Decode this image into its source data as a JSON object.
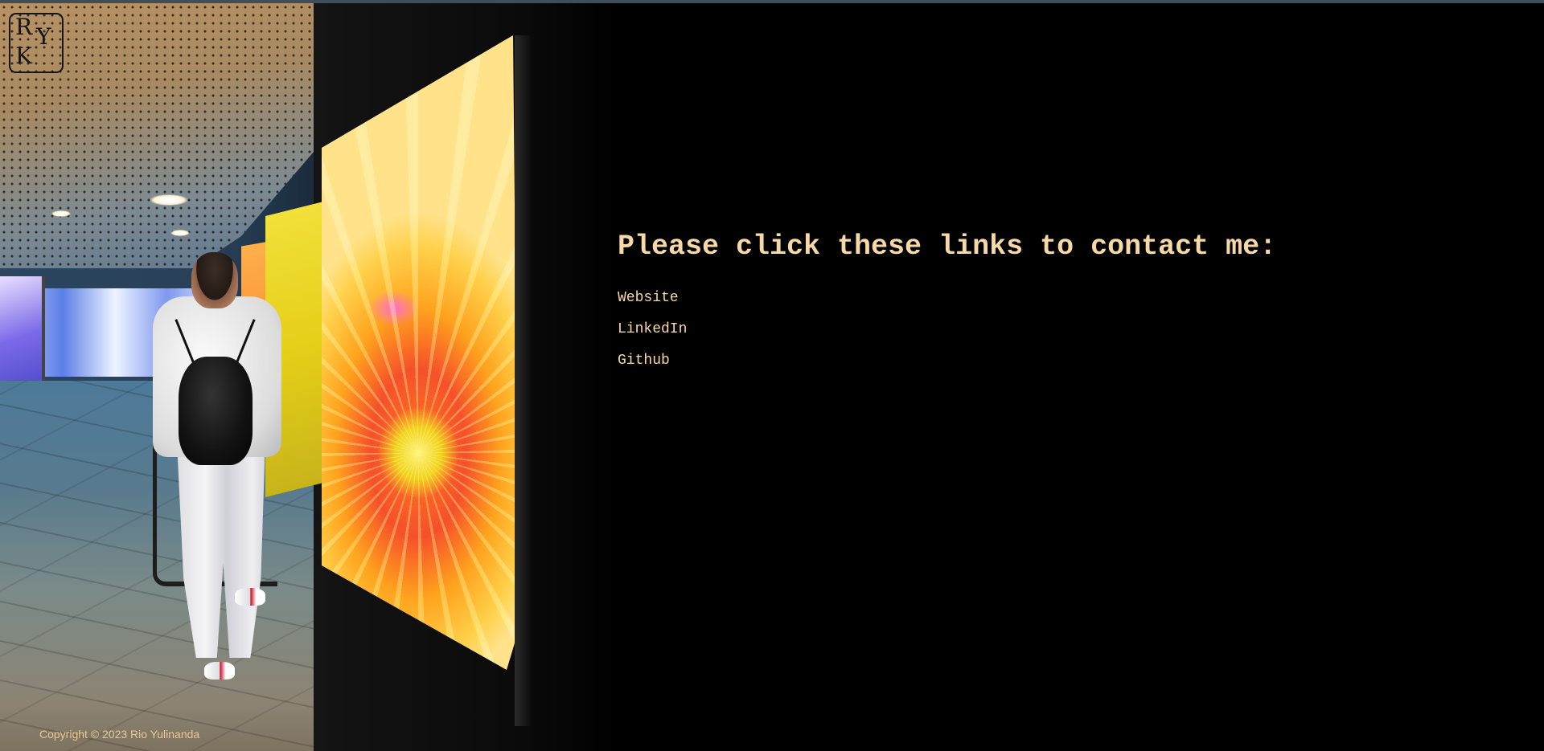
{
  "logo": {
    "line1": "R",
    "line2": "Y",
    "line3": "K"
  },
  "heading": "Please click these links to contact me:",
  "links": [
    {
      "label": "Website"
    },
    {
      "label": "LinkedIn"
    },
    {
      "label": "Github"
    }
  ],
  "footer": {
    "copyright": "Copyright © 2023 Rio Yulinanda"
  },
  "colors": {
    "accent_text": "#f6d9a6",
    "background": "#000000",
    "copyright": "#e8c894"
  }
}
